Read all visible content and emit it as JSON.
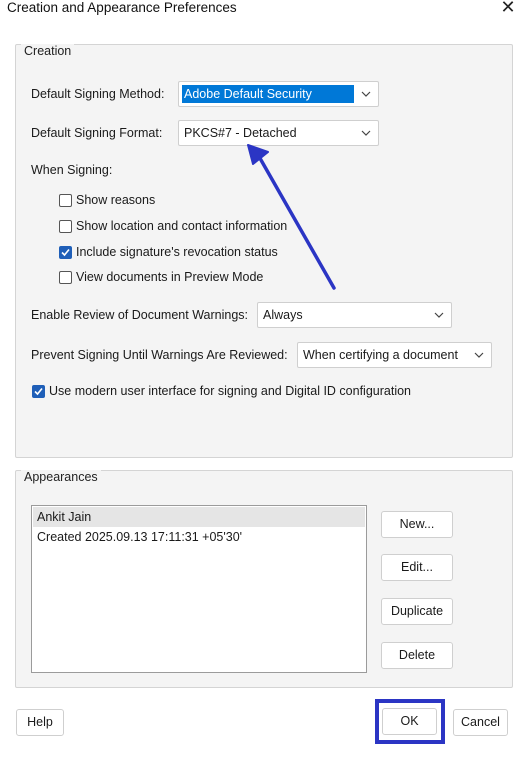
{
  "window": {
    "title": "Creation and Appearance Preferences"
  },
  "creation": {
    "legend": "Creation",
    "default_signing_method_label": "Default Signing Method:",
    "default_signing_method_value": "Adobe Default Security",
    "default_signing_format_label": "Default Signing Format:",
    "default_signing_format_value": "PKCS#7 - Detached",
    "when_signing_label": "When Signing:",
    "options": [
      {
        "label": "Show reasons",
        "checked": false
      },
      {
        "label": "Show location and contact information",
        "checked": false
      },
      {
        "label": "Include signature's revocation status",
        "checked": true
      },
      {
        "label": "View documents in Preview Mode",
        "checked": false
      }
    ],
    "enable_review_label": "Enable Review of Document Warnings:",
    "enable_review_value": "Always",
    "prevent_signing_label": "Prevent Signing Until Warnings Are Reviewed:",
    "prevent_signing_value": "When certifying a document",
    "modern_ui_label": "Use modern user interface for signing and Digital ID configuration",
    "modern_ui_checked": true
  },
  "appearances": {
    "legend": "Appearances",
    "items": [
      "Ankit Jain",
      "Created 2025.09.13 17:11:31 +05'30'"
    ],
    "new_label": "New...",
    "edit_label": "Edit...",
    "duplicate_label": "Duplicate",
    "delete_label": "Delete"
  },
  "footer": {
    "help_label": "Help",
    "ok_label": "OK",
    "cancel_label": "Cancel"
  },
  "colors": {
    "accent": "#0078d7",
    "checkbox": "#1f5fb8",
    "annotation": "#2b35c4"
  },
  "icons": [
    "close-icon",
    "chevron-down-icon",
    "checkmark-icon",
    "annotation-arrow"
  ]
}
